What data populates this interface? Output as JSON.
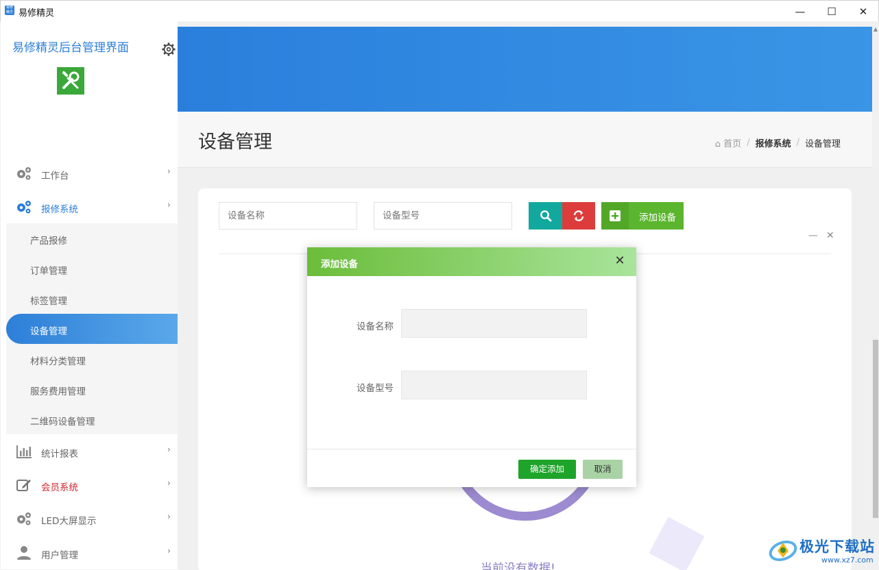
{
  "window": {
    "title": "易修精灵",
    "app_icon_text": "易修精灵",
    "minimize": "—",
    "maximize": "☐",
    "close": "✕"
  },
  "sidebar": {
    "title": "易修精灵后台管理界面",
    "menu": [
      {
        "label": "工作台",
        "icon": "gears-icon"
      },
      {
        "label": "报修系统",
        "icon": "gears-icon",
        "active": true
      },
      {
        "label": "统计报表",
        "icon": "bar-chart-icon"
      },
      {
        "label": "会员系统",
        "icon": "edit-icon",
        "color": "#d0262d"
      },
      {
        "label": "LED大屏显示",
        "icon": "gears-icon"
      },
      {
        "label": "用户管理",
        "icon": "user-icon"
      }
    ],
    "submenu": [
      {
        "label": "产品报修"
      },
      {
        "label": "订单管理"
      },
      {
        "label": "标签管理"
      },
      {
        "label": "设备管理",
        "active": true
      },
      {
        "label": "材料分类管理"
      },
      {
        "label": "服务费用管理"
      },
      {
        "label": "二维码设备管理"
      }
    ]
  },
  "page": {
    "title": "设备管理",
    "breadcrumb": {
      "home": "首页",
      "parent": "报修系统",
      "current": "设备管理",
      "sep": "/"
    }
  },
  "filters": {
    "name_placeholder": "设备名称",
    "model_placeholder": "设备型号",
    "add_label": "添加设备"
  },
  "card_tools": {
    "minimize": "—",
    "close": "✕"
  },
  "empty": {
    "text": "当前没有数据!"
  },
  "modal": {
    "title": "添加设备",
    "close": "✕",
    "fields": [
      {
        "label": "设备名称",
        "value": ""
      },
      {
        "label": "设备型号",
        "value": ""
      }
    ],
    "confirm_label": "确定添加",
    "cancel_label": "取消"
  },
  "watermark": {
    "text": "极光下载站",
    "url": "www.xz7.com"
  },
  "colors": {
    "accent": "#2d7fd8",
    "green": "#5bb52e",
    "red": "#dd3c3c",
    "teal": "#13a89e"
  }
}
